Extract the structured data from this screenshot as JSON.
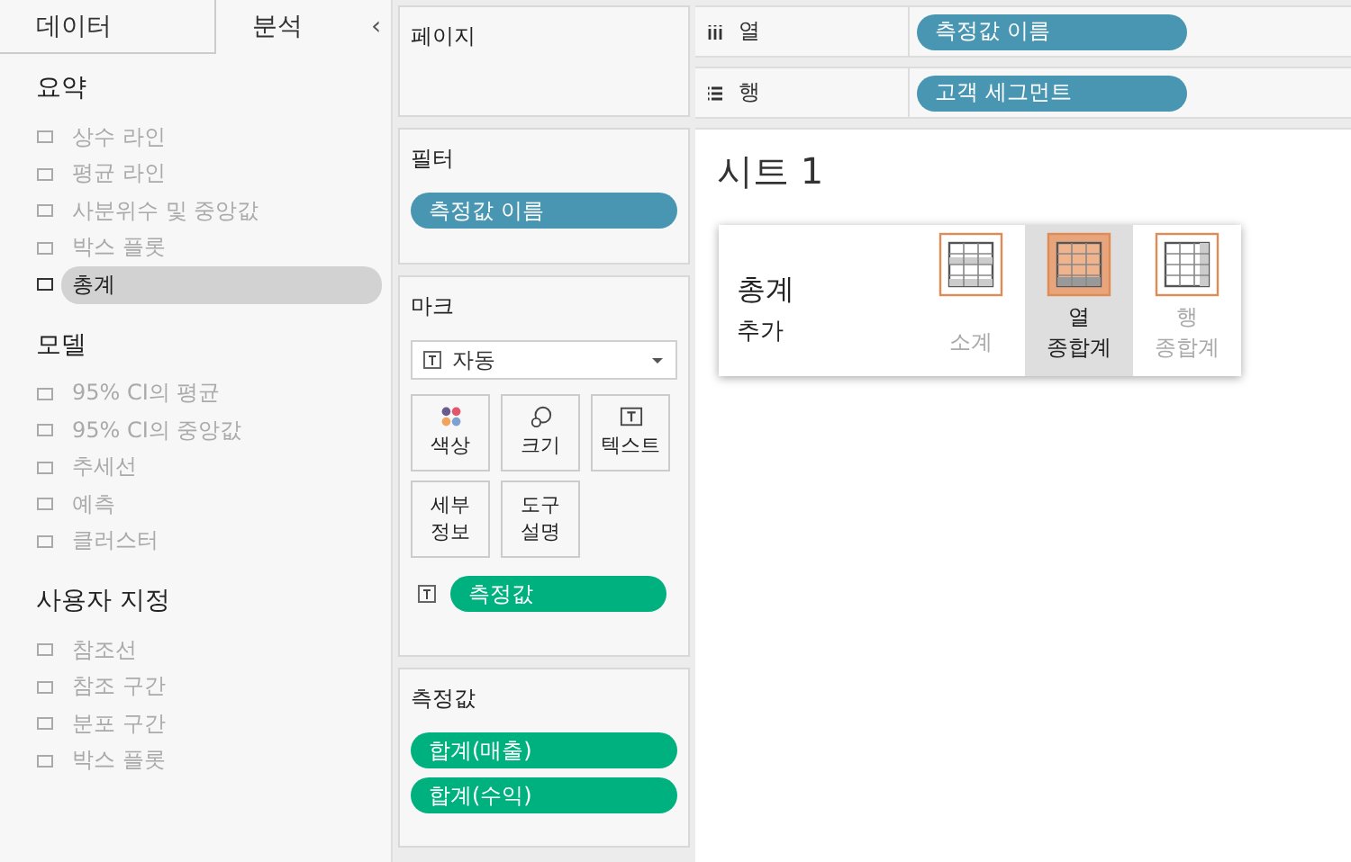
{
  "left_panel": {
    "tabs": [
      {
        "label": "데이터",
        "selected": false
      },
      {
        "label": "분석",
        "selected": true
      }
    ],
    "collapse": "‹",
    "groups": [
      {
        "title": "요약",
        "items": [
          {
            "label": "상수 라인",
            "disabled": true,
            "selected": false
          },
          {
            "label": "평균 라인",
            "disabled": true,
            "selected": false
          },
          {
            "label": "사분위수 및 중앙값",
            "disabled": true,
            "selected": false
          },
          {
            "label": "박스 플롯",
            "disabled": true,
            "selected": false
          },
          {
            "label": "총계",
            "disabled": false,
            "selected": true
          }
        ]
      },
      {
        "title": "모델",
        "items": [
          {
            "label": "95% CI의 평균",
            "disabled": true,
            "selected": false
          },
          {
            "label": "95% CI의 중앙값",
            "disabled": true,
            "selected": false
          },
          {
            "label": "추세선",
            "disabled": true,
            "selected": false
          },
          {
            "label": "예측",
            "disabled": true,
            "selected": false
          },
          {
            "label": "클러스터",
            "disabled": true,
            "selected": false
          }
        ]
      },
      {
        "title": "사용자 지정",
        "items": [
          {
            "label": "참조선",
            "disabled": true,
            "selected": false
          },
          {
            "label": "참조 구간",
            "disabled": true,
            "selected": false
          },
          {
            "label": "분포 구간",
            "disabled": true,
            "selected": false
          },
          {
            "label": "박스 플롯",
            "disabled": true,
            "selected": false
          }
        ]
      }
    ]
  },
  "pages_shelf": {
    "title": "페이지"
  },
  "filters_shelf": {
    "title": "필터",
    "pills": [
      {
        "label": "측정값 이름",
        "kind": "dimension"
      }
    ]
  },
  "marks": {
    "title": "마크",
    "mark_type": "자동",
    "cards": [
      "색상",
      "크기",
      "텍스트",
      "세부\n정보",
      "도구\n설명"
    ],
    "pills": [
      {
        "label": "측정값",
        "kind": "measure"
      }
    ]
  },
  "measure_values": {
    "title": "측정값",
    "pills": [
      {
        "label": "합계(매출)",
        "kind": "measure"
      },
      {
        "label": "합계(수익)",
        "kind": "measure"
      }
    ]
  },
  "columns_shelf": {
    "label": "열",
    "pills": [
      {
        "label": "측정값 이름",
        "kind": "dimension"
      }
    ]
  },
  "rows_shelf": {
    "label": "행",
    "pills": [
      {
        "label": "고객 세그먼트",
        "kind": "dimension"
      }
    ]
  },
  "sheet": {
    "title": "시트 1"
  },
  "totals_popup": {
    "title": "총계",
    "subtitle": "추가",
    "options": [
      {
        "label": "소계",
        "selected": false,
        "disabled": true
      },
      {
        "label": "열\n종합계",
        "selected": true,
        "disabled": false
      },
      {
        "label": "행\n종합계",
        "selected": false,
        "disabled": true
      }
    ]
  }
}
